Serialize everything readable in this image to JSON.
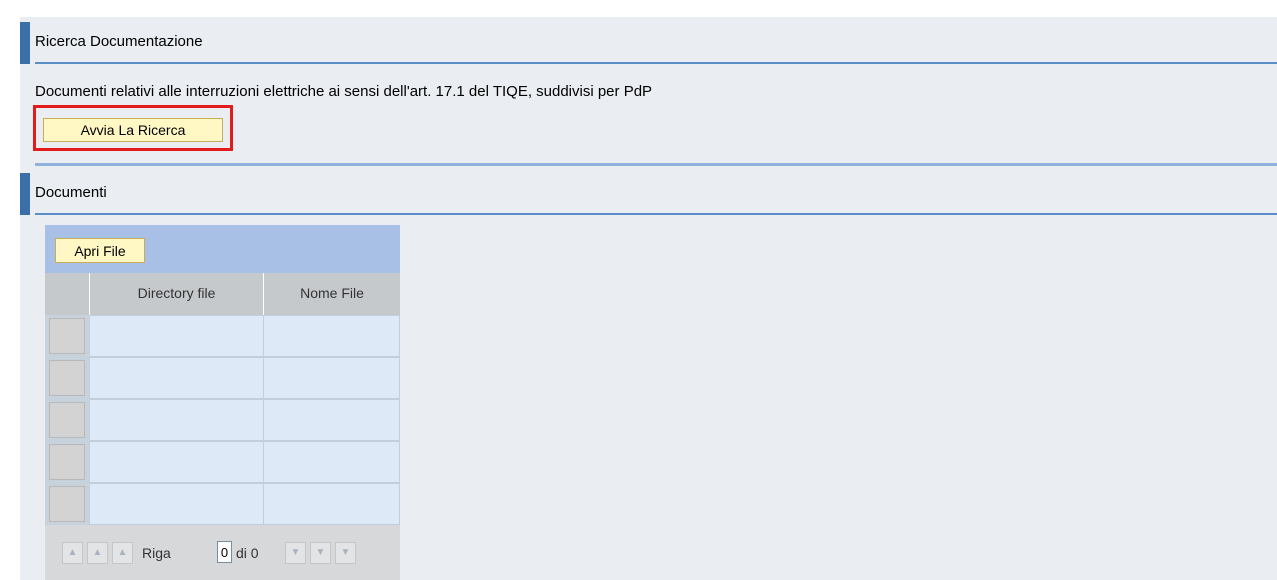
{
  "search_section": {
    "title": "Ricerca Documentazione",
    "description": "Documenti relativi alle interruzioni elettriche ai sensi dell'art. 17.1  del TIQE, suddivisi per PdP",
    "start_button_label": "Avvia La Ricerca"
  },
  "documents_section": {
    "title": "Documenti",
    "open_file_label": "Apri File",
    "table": {
      "columns": [
        "Directory file",
        "Nome File"
      ],
      "rows": [
        [
          "",
          ""
        ],
        [
          "",
          ""
        ],
        [
          "",
          ""
        ],
        [
          "",
          ""
        ],
        [
          "",
          ""
        ]
      ]
    },
    "pager": {
      "row_label": "Riga",
      "current_row": "0",
      "of_label": "di 0"
    }
  },
  "colors": {
    "accent": "#3a6fa8",
    "highlight_border": "#e31b1b",
    "button_bg": "#fff8c4"
  }
}
